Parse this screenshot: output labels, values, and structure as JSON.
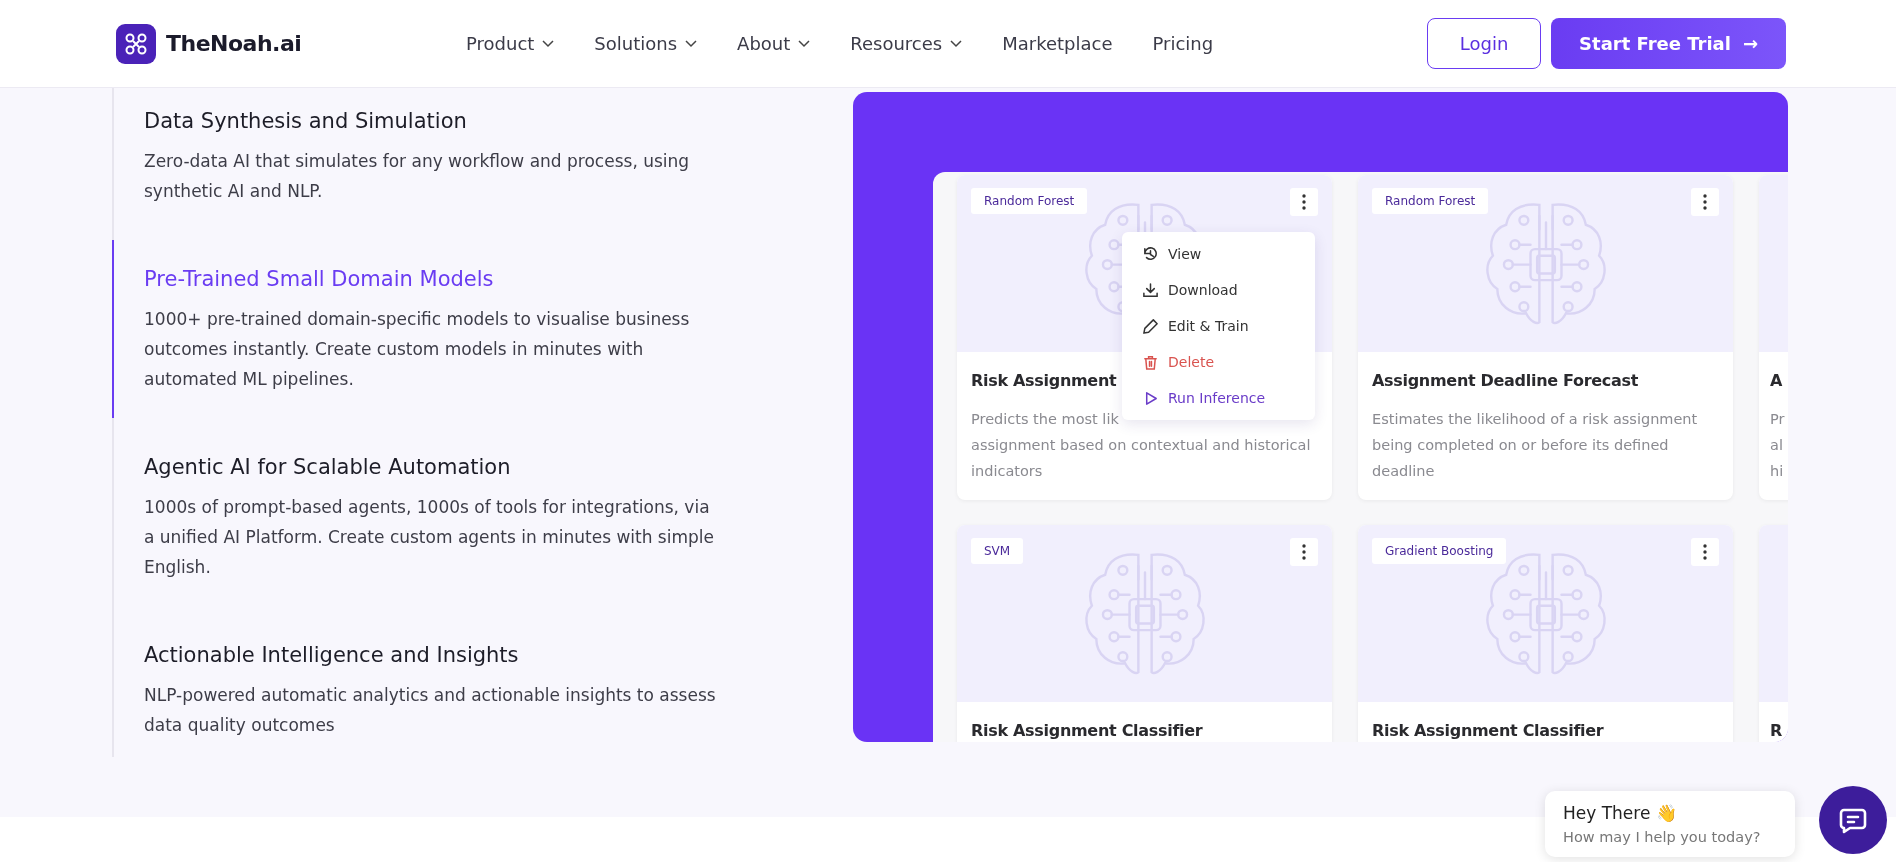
{
  "header": {
    "brand": "TheNoah.ai",
    "nav": [
      {
        "label": "Product",
        "dropdown": true
      },
      {
        "label": "Solutions",
        "dropdown": true
      },
      {
        "label": "About",
        "dropdown": true
      },
      {
        "label": "Resources",
        "dropdown": true
      },
      {
        "label": "Marketplace",
        "dropdown": false
      },
      {
        "label": "Pricing",
        "dropdown": false
      }
    ],
    "login": "Login",
    "cta": "Start Free Trial",
    "cta_arrow": "→"
  },
  "features": [
    {
      "title": "Data Synthesis and Simulation",
      "description": "Zero-data AI that simulates for any workflow and process, using synthetic AI and NLP.",
      "selected": false
    },
    {
      "title": "Pre-Trained Small Domain Models",
      "description": "1000+ pre-trained domain-specific models to visualise business outcomes instantly. Create custom models in minutes with automated ML pipelines.",
      "selected": true
    },
    {
      "title": "Agentic AI for Scalable Automation",
      "description": "1000s of prompt-based agents, 1000s of tools for integrations, via a unified AI Platform. Create custom agents in minutes with simple English.",
      "selected": false
    },
    {
      "title": "Actionable Intelligence and Insights",
      "description": "NLP-powered automatic analytics and actionable insights to assess data quality outcomes",
      "selected": false
    }
  ],
  "models": [
    {
      "tag": "Random Forest",
      "title": "Risk Assignment",
      "description_lines": [
        "Predicts the most lik",
        "assignment based on contextual and historical",
        "indicators"
      ],
      "menu_open": true
    },
    {
      "tag": "Random Forest",
      "title": "Assignment Deadline Forecast",
      "description_lines": [
        "Estimates the likelihood of a risk assignment",
        "being completed on or before its defined",
        "deadline"
      ],
      "menu_open": false
    },
    {
      "title": "A",
      "description_lines": [
        "Pr",
        "al",
        "hi"
      ]
    },
    {
      "tag": "SVM",
      "title": "Risk Assignment Classifier",
      "menu_open": false
    },
    {
      "tag": "Gradient Boosting",
      "title": "Risk Assignment Classifier",
      "menu_open": false
    },
    {
      "title": "R"
    }
  ],
  "menu": [
    {
      "label": "View",
      "kind": "normal"
    },
    {
      "label": "Download",
      "kind": "normal"
    },
    {
      "label": "Edit & Train",
      "kind": "normal"
    },
    {
      "label": "Delete",
      "kind": "danger"
    },
    {
      "label": "Run Inference",
      "kind": "primary"
    }
  ],
  "chat": {
    "greeting": "Hey There 👋",
    "prompt": "How may I help you today?"
  }
}
